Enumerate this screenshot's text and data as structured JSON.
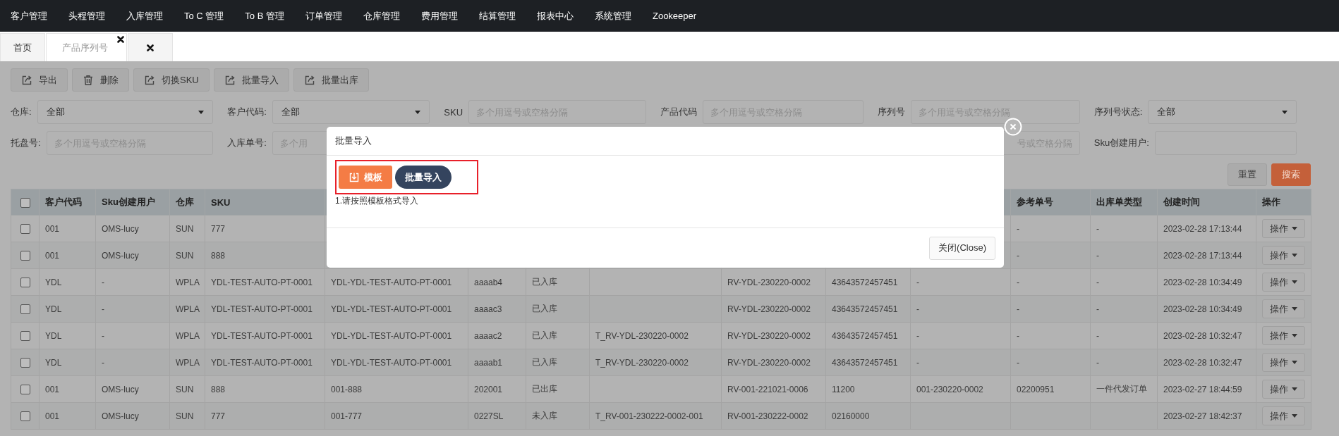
{
  "nav": {
    "items": [
      "客户管理",
      "头程管理",
      "入库管理",
      "To C 管理",
      "To B 管理",
      "订单管理",
      "仓库管理",
      "费用管理",
      "结算管理",
      "报表中心",
      "系统管理",
      "Zookeeper"
    ]
  },
  "tabs": [
    {
      "label": "首页",
      "selected": false,
      "closable": false
    },
    {
      "label": "产品序列号",
      "selected": true,
      "closable": true
    },
    {
      "selected": false,
      "closable": true
    }
  ],
  "toolbar": [
    {
      "label": "导出",
      "kind": "export"
    },
    {
      "label": "删除",
      "kind": "delete"
    },
    {
      "label": "切换SKU",
      "kind": "export"
    },
    {
      "label": "批量导入",
      "kind": "export"
    },
    {
      "label": "批量出库",
      "kind": "export"
    }
  ],
  "filters": [
    [
      {
        "label": "仓库:",
        "kind": "select",
        "value": "全部"
      },
      {
        "label": "客户代码:",
        "kind": "select",
        "value": "全部"
      },
      {
        "label": "SKU",
        "kind": "input",
        "placeholder": "多个用逗号或空格分隔"
      },
      {
        "label": "产品代码",
        "kind": "input",
        "placeholder": "多个用逗号或空格分隔"
      },
      {
        "label": "序列号",
        "kind": "input",
        "placeholder": "多个用逗号或空格分隔"
      },
      {
        "label": "序列号状态:",
        "kind": "select",
        "value": "全部"
      }
    ],
    [
      {
        "label": "托盘号:",
        "kind": "input",
        "placeholder": "多个用逗号或空格分隔"
      },
      {
        "label": "入库单号:",
        "kind": "input",
        "placeholder": "多个用"
      },
      {
        "kind": "input",
        "placeholder": "号或空格分隔",
        "clipped_start": true
      },
      {
        "label": "Sku创建用户:",
        "kind": "input"
      }
    ]
  ],
  "filter_actions": [
    {
      "label": "重置",
      "kind": "default"
    },
    {
      "label": "搜索",
      "kind": "primary"
    }
  ],
  "table": {
    "all_checked": false,
    "columns": [
      {
        "label": "客户代码"
      },
      {
        "label": "Sku创建用户"
      },
      {
        "label": "仓库"
      },
      {
        "label": "SKU"
      },
      {},
      {},
      {},
      {},
      {},
      {},
      {},
      {
        "label": "参考单号"
      },
      {
        "label": "出库单类型"
      },
      {
        "label": "创建时间"
      },
      {
        "label": "操作"
      }
    ],
    "rows": [
      {
        "checked": false,
        "action": "操作",
        "cells": [
          "001",
          "OMS-lucy",
          "SUN",
          "777",
          null,
          null,
          null,
          null,
          null,
          null,
          null,
          "-",
          "-",
          "2023-02-28 17:13:44"
        ]
      },
      {
        "checked": false,
        "action": "操作",
        "cells": [
          "001",
          "OMS-lucy",
          "SUN",
          "888",
          null,
          null,
          null,
          null,
          null,
          null,
          null,
          "-",
          "-",
          "2023-02-28 17:13:44"
        ]
      },
      {
        "checked": false,
        "action": "操作",
        "cells": [
          "YDL",
          "-",
          "WPLA",
          "YDL-TEST-AUTO-PT-0001",
          "YDL-YDL-TEST-AUTO-PT-0001",
          "aaaab4",
          "已入库",
          null,
          "RV-YDL-230220-0002",
          "43643572457451",
          "-",
          "-",
          "-",
          "2023-02-28 10:34:49"
        ]
      },
      {
        "checked": false,
        "action": "操作",
        "cells": [
          "YDL",
          "-",
          "WPLA",
          "YDL-TEST-AUTO-PT-0001",
          "YDL-YDL-TEST-AUTO-PT-0001",
          "aaaac3",
          "已入库",
          null,
          "RV-YDL-230220-0002",
          "43643572457451",
          "-",
          "-",
          "-",
          "2023-02-28 10:34:49"
        ]
      },
      {
        "checked": false,
        "action": "操作",
        "cells": [
          "YDL",
          "-",
          "WPLA",
          "YDL-TEST-AUTO-PT-0001",
          "YDL-YDL-TEST-AUTO-PT-0001",
          "aaaac2",
          "已入库",
          "T_RV-YDL-230220-0002",
          "RV-YDL-230220-0002",
          "43643572457451",
          "-",
          "-",
          "-",
          "2023-02-28 10:32:47"
        ]
      },
      {
        "checked": false,
        "action": "操作",
        "cells": [
          "YDL",
          "-",
          "WPLA",
          "YDL-TEST-AUTO-PT-0001",
          "YDL-YDL-TEST-AUTO-PT-0001",
          "aaaab1",
          "已入库",
          "T_RV-YDL-230220-0002",
          "RV-YDL-230220-0002",
          "43643572457451",
          "-",
          "-",
          "-",
          "2023-02-28 10:32:47"
        ]
      },
      {
        "checked": false,
        "action": "操作",
        "cells": [
          "001",
          "OMS-lucy",
          "SUN",
          "888",
          "001-888",
          "202001",
          "已出库",
          null,
          "RV-001-221021-0006",
          "11200",
          "001-230220-0002",
          "02200951",
          "一件代发订单",
          "2023-02-27 18:44:59"
        ]
      },
      {
        "checked": false,
        "action": "操作",
        "cells": [
          "001",
          "OMS-lucy",
          "SUN",
          "777",
          "001-777",
          "0227SL",
          "未入库",
          "T_RV-001-230222-0002-001",
          "RV-001-230222-0002",
          "02160000",
          null,
          null,
          null,
          "2023-02-27 18:42:37"
        ]
      }
    ]
  },
  "modal": {
    "title": "批量导入",
    "highlighted": true,
    "buttons": [
      {
        "label": "模板",
        "kind": "download"
      },
      {
        "label": "批量导入",
        "kind": "dark"
      }
    ],
    "note": "1.请按照模板格式导入",
    "footer_button": "关闭(Close)"
  }
}
